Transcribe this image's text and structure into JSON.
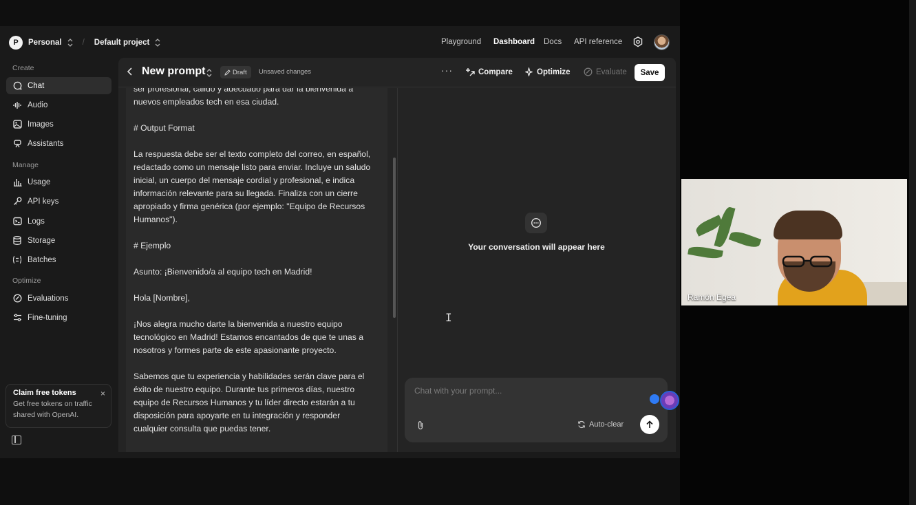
{
  "nav": {
    "org_initial": "P",
    "org_name": "Personal",
    "project": "Default project",
    "links": [
      "Playground",
      "Dashboard",
      "Docs",
      "API reference"
    ],
    "active_link": "Dashboard"
  },
  "sidebar": {
    "create_title": "Create",
    "create_items": [
      {
        "label": "Chat",
        "icon": "chat-icon"
      },
      {
        "label": "Audio",
        "icon": "audio-icon"
      },
      {
        "label": "Images",
        "icon": "images-icon"
      },
      {
        "label": "Assistants",
        "icon": "assistants-icon"
      }
    ],
    "manage_title": "Manage",
    "manage_items": [
      {
        "label": "Usage",
        "icon": "usage-icon"
      },
      {
        "label": "API keys",
        "icon": "key-icon"
      },
      {
        "label": "Logs",
        "icon": "logs-icon"
      },
      {
        "label": "Storage",
        "icon": "storage-icon"
      },
      {
        "label": "Batches",
        "icon": "batches-icon"
      }
    ],
    "optimize_title": "Optimize",
    "optimize_items": [
      {
        "label": "Evaluations",
        "icon": "evaluations-icon"
      },
      {
        "label": "Fine-tuning",
        "icon": "fine-tuning-icon"
      }
    ],
    "claim": {
      "title": "Claim free tokens",
      "desc": "Get free tokens on traffic shared with OpenAI."
    }
  },
  "toolbar": {
    "title": "New prompt",
    "draft": "Draft",
    "unsaved": "Unsaved changes",
    "compare": "Compare",
    "optimize": "Optimize",
    "evaluate": "Evaluate",
    "save": "Save"
  },
  "editor": {
    "text": "ser profesional, cálido y adecuado para dar la bienvenida a\nnuevos empleados tech en esa ciudad.\n\n# Output Format\n\nLa respuesta debe ser el texto completo del correo, en español,\nredactado como un mensaje listo para enviar. Incluye un saludo\ninicial, un cuerpo del mensaje cordial y profesional, e indica\ninformación relevante para su llegada. Finaliza con un cierre\napropiado y firma genérica (por ejemplo: \"Equipo de Recursos\nHumanos\").\n\n# Ejemplo\n\nAsunto: ¡Bienvenido/a al equipo tech en Madrid!\n\nHola [Nombre],\n\n¡Nos alegra mucho darte la bienvenida a nuestro equipo\ntecnológico en Madrid! Estamos encantados de que te unas a\nnosotros y formes parte de este apasionante proyecto.\n\nSabemos que tu experiencia y habilidades serán clave para el\néxito de nuestro equipo. Durante tus primeros días, nuestro\nequipo de Recursos Humanos y tu líder directo estarán a tu\ndisposición para apoyarte en tu integración y responder\ncualquier consulta que puedas tener."
  },
  "conversation": {
    "empty_text": "Your conversation will appear here",
    "input_placeholder": "Chat with your prompt...",
    "autoclear": "Auto-clear"
  },
  "video": {
    "participant_name": "Ramón Egea"
  },
  "colors": {
    "background": "#1a1a1a",
    "panel": "#242424",
    "accent_white": "#ffffff",
    "bubble_blue": "#2f7bf5"
  }
}
